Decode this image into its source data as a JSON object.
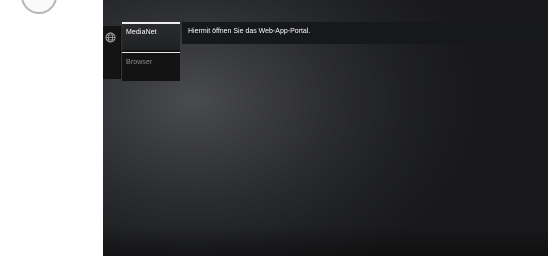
{
  "menu": {
    "rail_icon": "globe-icon",
    "items": [
      {
        "label": "MediaNet",
        "state": "selected"
      },
      {
        "label": "Browser",
        "state": "unselected"
      }
    ]
  },
  "description": {
    "text": "Hiermit öffnen Sie das Web-App-Portal."
  },
  "colors": {
    "screen_background": "#19191b",
    "selected_text": "#ffffff",
    "unselected_text": "#8d8d90"
  }
}
